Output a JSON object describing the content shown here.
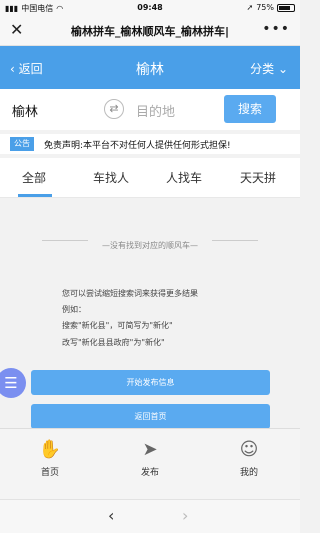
{
  "status": {
    "carrier": "中国电信",
    "time": "09:48",
    "battery": "75%"
  },
  "browser": {
    "title": "榆林拼车_榆林顺风车_榆林拼车|",
    "close_icon": "close-icon",
    "more_icon": "more-dots-icon"
  },
  "header": {
    "back_label": "返回",
    "city": "榆林",
    "category_label": "分类"
  },
  "search": {
    "from_value": "榆林",
    "dest_placeholder": "目的地",
    "button_label": "搜索"
  },
  "notice": {
    "tag": "公告",
    "text": "免责声明:本平台不对任何人提供任何形式担保!"
  },
  "tabs": [
    {
      "label": "全部",
      "active": true
    },
    {
      "label": "车找人",
      "active": false
    },
    {
      "label": "人找车",
      "active": false
    },
    {
      "label": "天天拼",
      "active": false
    }
  ],
  "empty": {
    "message": "没有找到对应的顺风车",
    "hint_line1": "您可以尝试缩短搜索词来获得更多结果",
    "hint_line2": "例如：",
    "hint_line3": "搜索\"新化县\"，可简写为\"新化\"",
    "hint_line4": "改写\"新化县县政府\"为\"新化\""
  },
  "actions": {
    "publish_label": "开始发布信息",
    "home_label": "返回首页"
  },
  "bottom_nav": [
    {
      "label": "首页",
      "icon": "hand-icon"
    },
    {
      "label": "发布",
      "icon": "paper-plane-icon"
    },
    {
      "label": "我的",
      "icon": "user-icon"
    }
  ],
  "colors": {
    "accent": "#4a9fe8",
    "button": "#5aaaf0",
    "float": "#7b8ff0"
  }
}
